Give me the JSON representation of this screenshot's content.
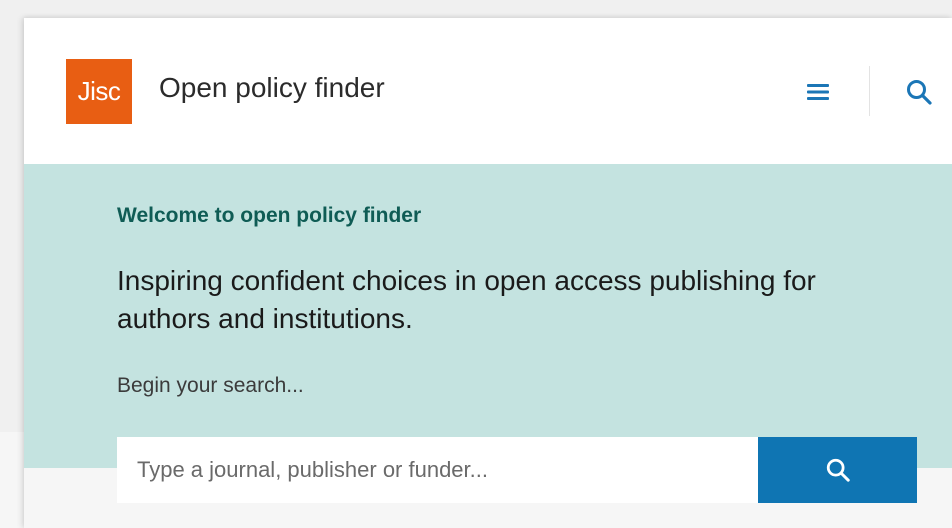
{
  "header": {
    "logo_text": "Jisc",
    "site_title": "Open policy finder",
    "menu_icon": "hamburger-menu-icon",
    "search_icon": "search-icon",
    "colors": {
      "logo_bg": "#e85e13",
      "icon": "#1b76b6"
    }
  },
  "hero": {
    "kicker": "Welcome to open policy finder",
    "tagline": "Inspiring confident choices in open access publishing for authors and institutions.",
    "begin_label": "Begin your search...",
    "colors": {
      "bg": "#c4e3e0",
      "kicker": "#0f5c55"
    }
  },
  "search": {
    "value": "",
    "placeholder": "Type a journal, publisher or funder...",
    "button_icon": "search-icon",
    "colors": {
      "button_bg": "#0f75b3"
    }
  }
}
